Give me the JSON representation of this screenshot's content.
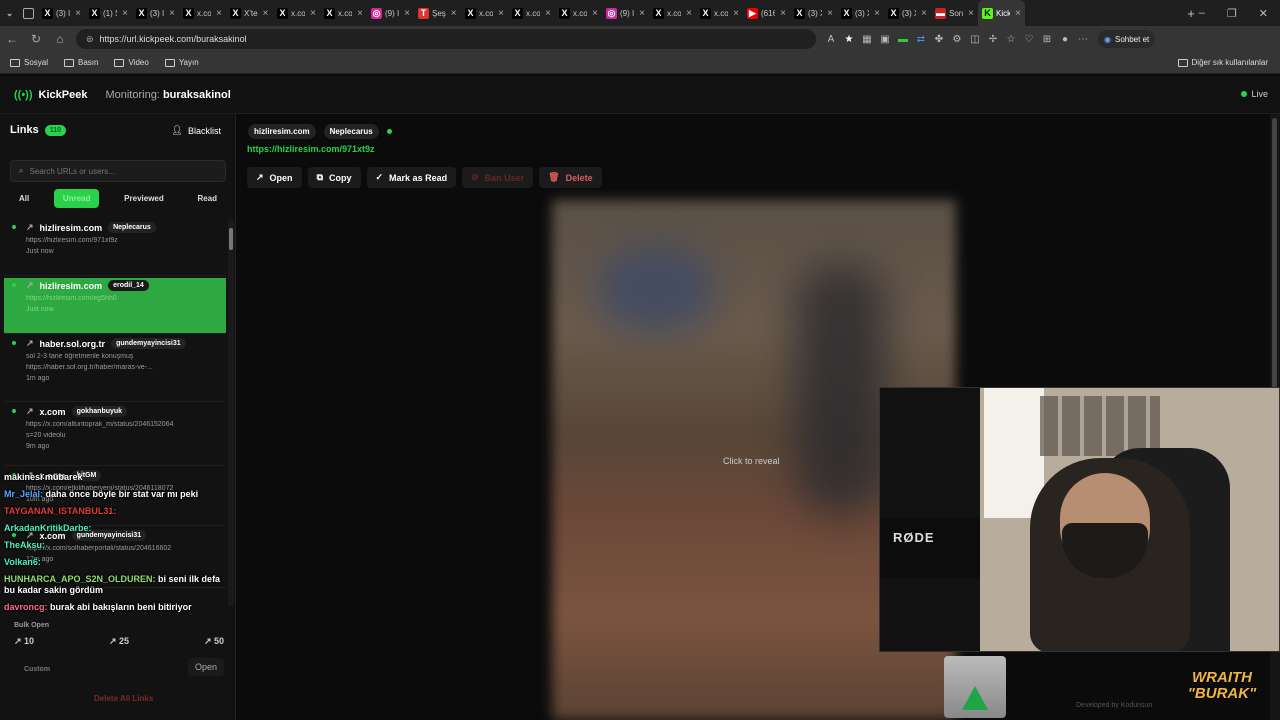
{
  "browser": {
    "tabs": [
      {
        "icon": "x-icon",
        "label": "(3) I"
      },
      {
        "icon": "x-icon",
        "label": "(1) S"
      },
      {
        "icon": "x-icon",
        "label": "(3) I"
      },
      {
        "icon": "x-icon",
        "label": "x.co"
      },
      {
        "icon": "x-icon",
        "label": "X'te"
      },
      {
        "icon": "x-icon",
        "label": "x.co"
      },
      {
        "icon": "x-icon",
        "label": "x.co"
      },
      {
        "icon": "instagram-icon",
        "label": "(9) I"
      },
      {
        "icon": "red-icon",
        "label": "Şeş"
      },
      {
        "icon": "x-icon",
        "label": "x.co"
      },
      {
        "icon": "x-icon",
        "label": "x.com/"
      },
      {
        "icon": "x-icon",
        "label": "x.com/"
      },
      {
        "icon": "instagram-icon",
        "label": "(9) Inst"
      },
      {
        "icon": "x-icon",
        "label": "x.com/"
      },
      {
        "icon": "x-icon",
        "label": "x.com/"
      },
      {
        "icon": "youtube-icon",
        "label": "(616)"
      },
      {
        "icon": "x-icon",
        "label": "(3) X'te"
      },
      {
        "icon": "x-icon",
        "label": "(3) X'te"
      },
      {
        "icon": "x-icon",
        "label": "(3) X'te"
      },
      {
        "icon": "news-icon",
        "label": "Son da"
      },
      {
        "icon": "kick-icon",
        "label": "Kick"
      }
    ],
    "url": "https://url.kickpeek.com/buraksakinol",
    "sohbet_label": "Sohbet et",
    "bookmarks": [
      "Sosyal",
      "Basın",
      "Video",
      "Yayın"
    ],
    "other_bookmarks": "Diğer sık kullanılanlar"
  },
  "app": {
    "brand": "KickPeek",
    "monitoring_label": "Monitoring:",
    "monitoring_user": "buraksakinol",
    "live_label": "Live"
  },
  "sidebar": {
    "title": "Links",
    "count": "110",
    "blacklist_label": "Blacklist",
    "search_placeholder": "Search URLs or users...",
    "filters": [
      "All",
      "Unread",
      "Previewed",
      "Read"
    ],
    "active_filter": "Unread",
    "items": [
      {
        "domain": "hizliresim.com",
        "user": "Neplecarus",
        "lines": [
          "https://hizliresim.com/971xt9z"
        ],
        "time": "Just now"
      },
      {
        "domain": "hizliresim.com",
        "user": "erodil_14",
        "lines": [
          "https://hizliresim.com/eg5hh0"
        ],
        "time": "Just now"
      },
      {
        "domain": "haber.sol.org.tr",
        "user": "gundemyayincisi31",
        "lines": [
          "sol 2-3 tane öğretmenle konuşmuş",
          "https://haber.sol.org.tr/haber/maras-ve-..."
        ],
        "time": "1m ago"
      },
      {
        "domain": "x.com",
        "user": "gokhanbuyuk",
        "lines": [
          "https://x.com/altuntoprak_m/status/2046152064",
          "s=20 videolu"
        ],
        "time": "9m ago"
      },
      {
        "domain": "x.com",
        "user": "bitGM",
        "lines": [
          "https://x.com/etkilihaberyeni/status/2046118072"
        ],
        "time": "10m ago"
      },
      {
        "domain": "x.com",
        "user": "gundemyayincisi31",
        "lines": [
          "https://x.com/solhaberportali/status/204616602"
        ],
        "time": "12m ago"
      }
    ],
    "stats": [
      "10",
      "25",
      "50"
    ],
    "bulk_open": "Bulk Open",
    "open_label": "Open",
    "custom_label": "Custom",
    "delete_all": "Delete All Links"
  },
  "chat": [
    {
      "name": "",
      "text": "makinesi mübarek",
      "color": "plain"
    },
    {
      "name": "Mr_Jelal:",
      "text": "daha önce böyle bir stat var mı peki",
      "color": "blue"
    },
    {
      "name": "TAYGANAN_ISTANBUL31:",
      "text": "",
      "color": "red"
    },
    {
      "name": "ArkadanKritikDarbe:",
      "text": "",
      "color": "cyan"
    },
    {
      "name": "TheAksu:",
      "text": "",
      "color": "cyan"
    },
    {
      "name": "Volkan6:",
      "text": "",
      "color": "cyan"
    },
    {
      "name": "HUNHARCA_APO_S2N_OLDUREN:",
      "text": "bi seni ilk defa bu kadar sakin gördüm",
      "color": "green"
    },
    {
      "name": "davroncg:",
      "text": "burak abi bakışların beni bitiriyor",
      "color": "pink"
    }
  ],
  "main": {
    "domain_chip": "hizliresim.com",
    "user_chip": "Neplecarus",
    "url": "https://hizliresim.com/971xt9z",
    "actions": [
      "Open",
      "Copy",
      "Mark as Read",
      "Ban User",
      "Delete"
    ],
    "reveal_text": "Click to reveal"
  },
  "overlay": {
    "mic_brand": "RØDE",
    "wraith_line1": "WRAITH",
    "wraith_line2": "\"BURAK\"",
    "developed_by": "Developed by Kodunsun"
  },
  "colors": {
    "accent": "#29d24a",
    "danger": "#d85c5c"
  }
}
